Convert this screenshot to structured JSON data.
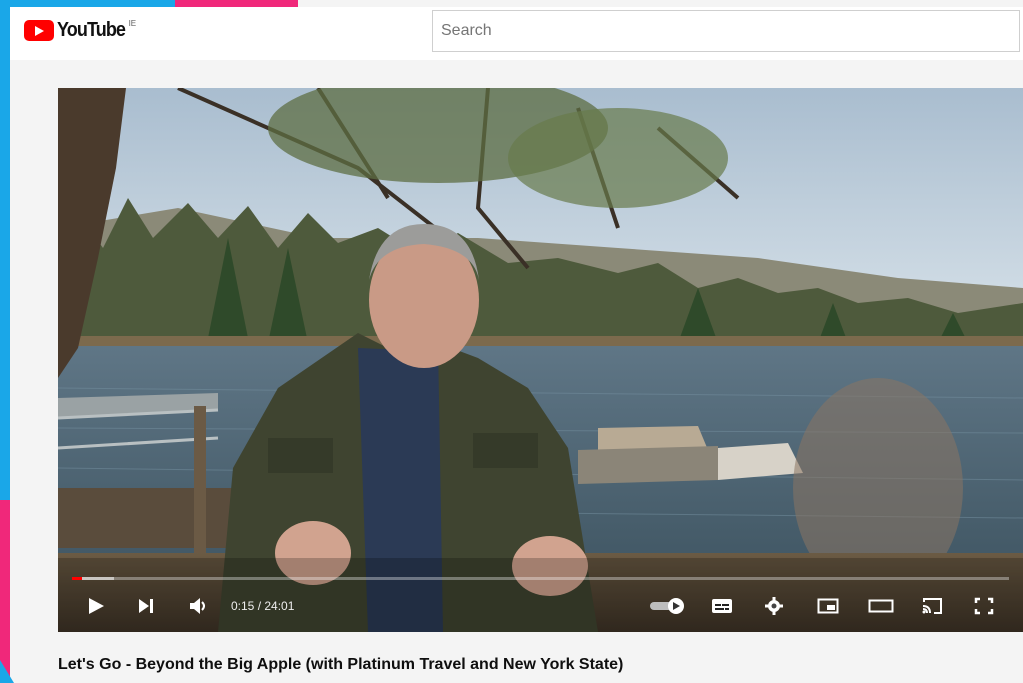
{
  "header": {
    "logo_text": "YouTube",
    "region": "IE",
    "search": {
      "placeholder": "Search",
      "value": ""
    }
  },
  "player": {
    "current_time": "0:15",
    "duration": "24:01",
    "time_display": "0:15 / 24:01",
    "progress_fraction": 0.0104,
    "buffered_fraction": 0.045,
    "autoplay_on": true,
    "controls": [
      "play-icon",
      "next-icon",
      "volume-icon",
      "autoplay-toggle-icon",
      "subtitles-icon",
      "settings-gear-icon",
      "miniplayer-icon",
      "theater-mode-icon",
      "cast-icon",
      "fullscreen-icon"
    ]
  },
  "video": {
    "title": "Let's Go - Beyond the Big Apple (with Platinum Travel and New York State)"
  },
  "colors": {
    "brand_red": "#ff0000",
    "accent_blue": "#1aa7e8",
    "accent_pink": "#f0287a"
  }
}
